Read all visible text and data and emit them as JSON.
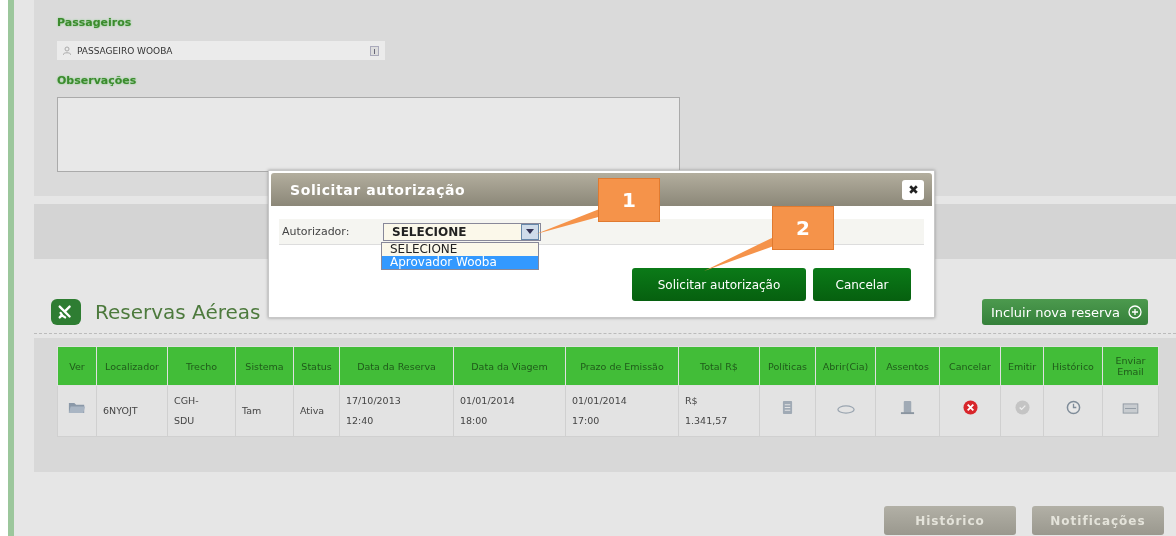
{
  "passengers": {
    "heading": "Passageiros",
    "items": [
      "PASSAGEIRO WOOBA"
    ]
  },
  "observations": {
    "heading": "Observações"
  },
  "reservations": {
    "title": "Reservas Aéreas",
    "add_button": "Incluir nova reserva",
    "table": {
      "columns": [
        "Ver",
        "Localizador",
        "Trecho",
        "Sistema",
        "Status",
        "Data da Reserva",
        "Data da Viagem",
        "Prazo de Emissão",
        "Total R$",
        "Políticas",
        "Abrir(Cia)",
        "Assentos",
        "Cancelar",
        "Emitir",
        "Histórico",
        "Enviar Email"
      ],
      "rows": [
        [
          {
            "kind": "icon"
          },
          {
            "kind": "text",
            "text": "6NYOJT"
          },
          {
            "kind": "text",
            "text": "CGH-\nSDU"
          },
          {
            "kind": "text",
            "text": "Tam"
          },
          {
            "kind": "text",
            "text": "Ativa"
          },
          {
            "kind": "text",
            "text": "17/10/2013\n12:40"
          },
          {
            "kind": "text",
            "text": "01/01/2014\n18:00"
          },
          {
            "kind": "text",
            "text": "01/01/2014\n17:00"
          },
          {
            "kind": "text",
            "text": "R$\n1.341,57"
          },
          {
            "kind": "icon"
          },
          {
            "kind": "icon"
          },
          {
            "kind": "icon"
          },
          {
            "kind": "icon"
          },
          {
            "kind": "icon",
            "disabled": true
          },
          {
            "kind": "icon"
          },
          {
            "kind": "icon"
          }
        ]
      ]
    }
  },
  "footer_buttons": [
    "Histórico",
    "Notificações"
  ],
  "dialog": {
    "title": "Solicitar autorização",
    "field_label": "Autorizador:",
    "select_value": "SELECIONE",
    "options": [
      {
        "label": "SELECIONE",
        "selected": false
      },
      {
        "label": "Aprovador Wooba",
        "selected": true
      }
    ],
    "buttons": [
      "Solicitar autorização",
      "Cancelar"
    ]
  },
  "callouts": [
    "1",
    "2"
  ]
}
